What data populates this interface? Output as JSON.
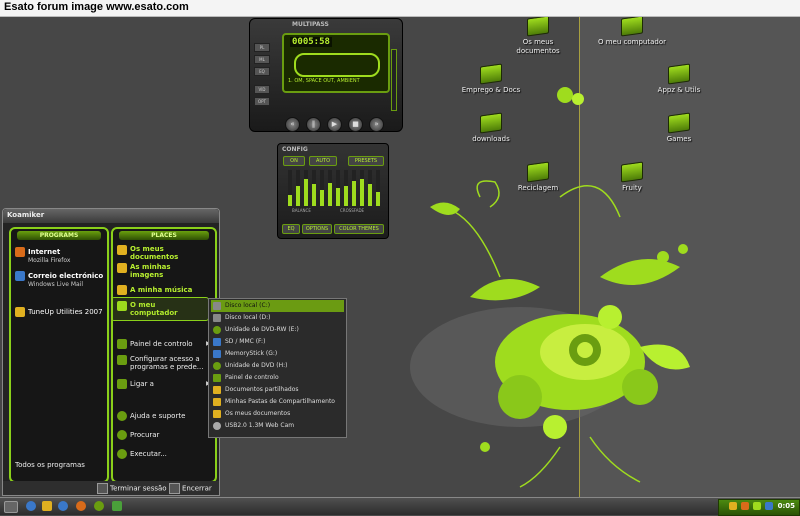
{
  "titlebar": {
    "text": "Esato forum image www.esato.com"
  },
  "desktop_icons": [
    {
      "name": "my-docs",
      "label": "Os meus documentos"
    },
    {
      "name": "my-computer",
      "label": "O meu computador"
    },
    {
      "name": "emprego",
      "label": "Emprego & Docs"
    },
    {
      "name": "appz",
      "label": "Appz & Utils"
    },
    {
      "name": "downloads",
      "label": "downloads"
    },
    {
      "name": "games",
      "label": "Games"
    },
    {
      "name": "recycle",
      "label": "Reciclagem"
    },
    {
      "name": "fruity",
      "label": "Fruity"
    }
  ],
  "player": {
    "title": "MULTIPASS",
    "time": "0005:58",
    "track": "1. OM, SPACE OUT, AMBIENT",
    "side_buttons": [
      "PL",
      "ML",
      "EQ",
      "VID",
      "OPT"
    ]
  },
  "config": {
    "title": "CONFIG",
    "on": "ON",
    "auto": "AUTO",
    "presets": "PRESETS",
    "balance": "BALANCE",
    "crossfade": "CROSSFADE",
    "eq_levels": [
      0.3,
      0.55,
      0.75,
      0.6,
      0.45,
      0.65,
      0.5,
      0.55,
      0.7,
      0.75,
      0.6,
      0.4
    ],
    "buttons": [
      "EQ",
      "OPTIONS",
      "COLOR THEMES"
    ]
  },
  "startmenu": {
    "user": "Koamiker",
    "programs_header": "PROGRAMS",
    "places_header": "PLACES",
    "programs": [
      {
        "title": "Internet",
        "sub": "Mozilla Firefox"
      },
      {
        "title": "Correio electrónico",
        "sub": "Windows Live Mail"
      },
      {
        "title": "TuneUp Utilities 2007",
        "sub": ""
      }
    ],
    "places": [
      {
        "label": "Os meus documentos"
      },
      {
        "label": "As minhas imagens"
      },
      {
        "label": "A minha música"
      },
      {
        "label": "O meu computador"
      }
    ],
    "system": [
      {
        "label": "Painel de controlo"
      },
      {
        "label": "Configurar acesso a programas e prede..."
      },
      {
        "label": "Ligar a"
      },
      {
        "label": "Ajuda e suporte"
      },
      {
        "label": "Procurar"
      },
      {
        "label": "Executar..."
      }
    ],
    "all_programs": "Todos os programas",
    "logoff": "Terminar sessão",
    "shutdown": "Encerrar"
  },
  "submenu": [
    "Disco local (C:)",
    "Disco local (D:)",
    "Unidade de DVD-RW (E:)",
    "SD / MMC (F:)",
    "MemoryStick (G:)",
    "Unidade de DVD (H:)",
    "Painel de controlo",
    "Documentos partilhados",
    "Minhas Pastas de Compartilhamento",
    "Os meus documentos",
    "USB2.0 1.3M Web Cam"
  ],
  "taskbar": {
    "clock": "0:05"
  }
}
